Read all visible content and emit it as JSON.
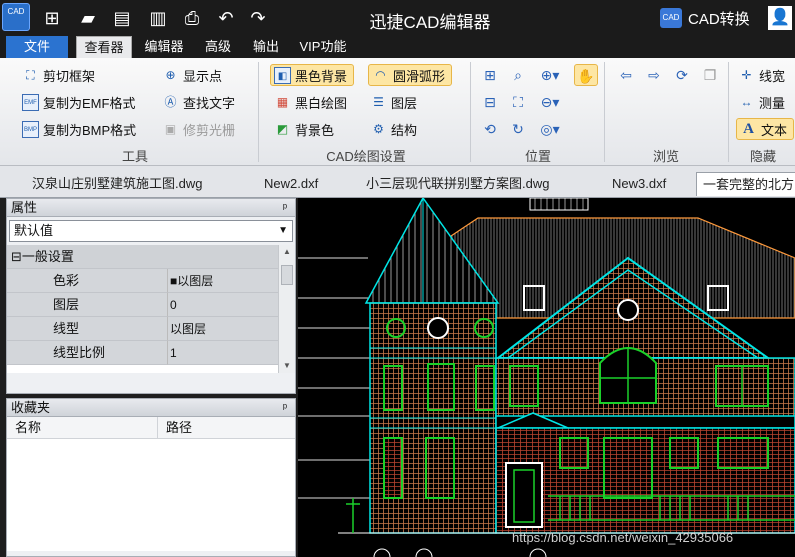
{
  "app": {
    "title": "迅捷CAD编辑器",
    "logo_text": "CAD",
    "convert_label": "CAD转换",
    "convert_icon_text": "CAD"
  },
  "menu": [
    "文件",
    "查看器",
    "编辑器",
    "高级",
    "输出",
    "VIP功能"
  ],
  "ribbon": {
    "tools": {
      "label": "工具",
      "items": [
        "剪切框架",
        "复制为EMF格式",
        "复制为BMP格式",
        "显示点",
        "查找文字",
        "修剪光栅"
      ],
      "emf_icon": "EMF",
      "bmp_icon": "BMP"
    },
    "draw": {
      "label": "CAD绘图设置",
      "items": [
        "黑色背景",
        "圆滑弧形",
        "黑白绘图",
        "图层",
        "背景色",
        "结构"
      ]
    },
    "position": {
      "label": "位置"
    },
    "browse": {
      "label": "浏览"
    },
    "hide": {
      "label": "隐藏",
      "items": [
        "线宽",
        "测量",
        "文本"
      ]
    }
  },
  "documents": [
    "汉泉山庄别墅建筑施工图.dwg",
    "New2.dxf",
    "小三层现代联拼别墅方案图.dwg",
    "New3.dxf",
    "一套完整的北方"
  ],
  "properties": {
    "title": "属性",
    "pin": "ᵖ",
    "combo_value": "默认值",
    "section": "一般设置",
    "section_toggle": "⊟",
    "rows": [
      {
        "key": "色彩",
        "value": "■以图层"
      },
      {
        "key": "图层",
        "value": "0"
      },
      {
        "key": "线型",
        "value": "以图层"
      },
      {
        "key": "线型比例",
        "value": "1"
      }
    ]
  },
  "favorites": {
    "title": "收藏夹",
    "pin": "ᵖ",
    "columns": [
      "名称",
      "路径"
    ]
  },
  "watermark": "https://blog.csdn.net/weixin_42935066",
  "colors": {
    "accent": "#2b73d0",
    "cad_cyan": "#00e5e5",
    "cad_orange": "#ff9a3c",
    "cad_green": "#1ad12a",
    "cad_white": "#ffffff",
    "cad_red": "#e0493a"
  }
}
